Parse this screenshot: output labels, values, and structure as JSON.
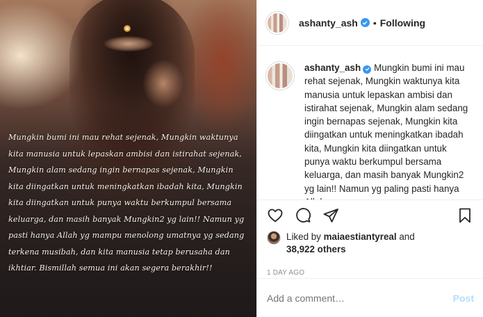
{
  "post": {
    "username": "ashanty_ash",
    "follow_status": "Following",
    "separator": "•",
    "image_overlay_text": "Mungkin bumi ini mau rehat sejenak, Mungkin waktunya kita manusia untuk lepaskan ambisi dan istirahat sejenak, Mungkin alam sedang ingin bernapas sejenak, Mungkin kita diingatkan untuk meningkatkan ibadah kita, Mungkin kita diingatkan untuk punya waktu berkumpul bersama keluarga, dan masih banyak Mungkin2 yg lain!! Namun yg pasti hanya Allah yg mampu menolong umatnya yg sedang terkena musibah, dan kita manusia tetap berusaha dan ikhtiar. Bismillah semua ini akan segera berakhir!!",
    "caption_user": "ashanty_ash",
    "caption_text": "Mungkin bumi ini mau rehat sejenak, Mungkin waktunya kita manusia untuk lepaskan ambisi dan istirahat sejenak, Mungkin alam sedang ingin bernapas sejenak, Mungkin kita diingatkan untuk meningkatkan ibadah kita, Mungkin kita diingatkan untuk punya waktu berkumpul bersama keluarga, dan masih banyak Mungkin2 yg lain!! Namun yg paling pasti hanya Allah yg",
    "likes_prefix": "Liked by",
    "liked_by_user": "maiaestiantyreal",
    "likes_and": "and",
    "likes_count": "38,922 others",
    "timestamp": "1 DAY AGO"
  },
  "comment": {
    "placeholder": "Add a comment…",
    "post_label": "Post"
  },
  "icons": {
    "like": "heart-icon",
    "comment": "speech-bubble-icon",
    "share": "paper-plane-icon",
    "save": "bookmark-icon",
    "verified": "verified-badge-icon"
  },
  "colors": {
    "verified": "#3897f0",
    "post_disabled": "#b2dffc",
    "muted": "#8e8e8e",
    "text": "#262626"
  }
}
